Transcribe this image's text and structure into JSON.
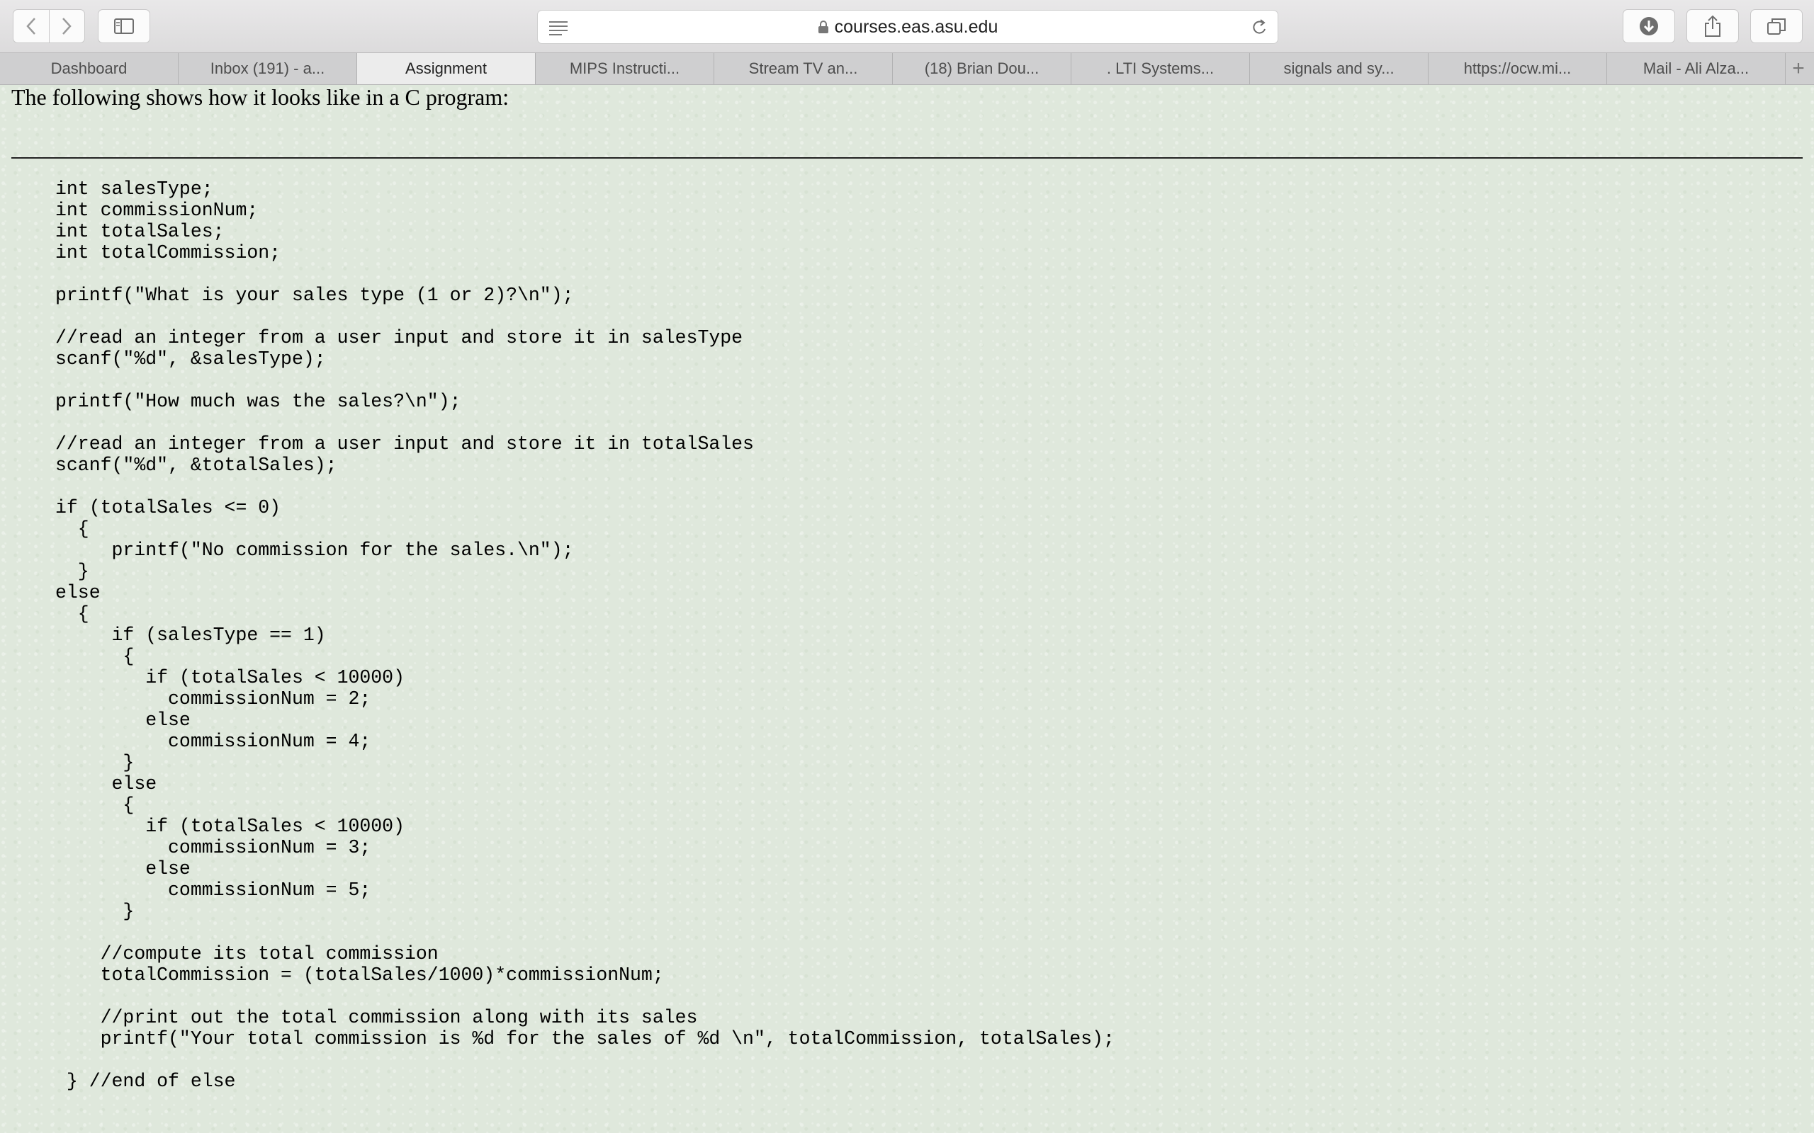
{
  "toolbar": {
    "url": "courses.eas.asu.edu"
  },
  "tabs": [
    {
      "label": "Dashboard"
    },
    {
      "label": "Inbox (191) - a..."
    },
    {
      "label": "Assignment"
    },
    {
      "label": "MIPS Instructi..."
    },
    {
      "label": "Stream TV an..."
    },
    {
      "label": "(18) Brian Dou..."
    },
    {
      "label": ". LTI Systems..."
    },
    {
      "label": "signals and sy..."
    },
    {
      "label": "https://ocw.mi..."
    },
    {
      "label": "Mail - Ali Alza..."
    }
  ],
  "page": {
    "intro": "The following shows how it looks like in a C program:",
    "code": "int salesType;\nint commissionNum;\nint totalSales;\nint totalCommission;\n\nprintf(\"What is your sales type (1 or 2)?\\n\");\n\n//read an integer from a user input and store it in salesType\nscanf(\"%d\", &salesType);\n\nprintf(\"How much was the sales?\\n\");\n\n//read an integer from a user input and store it in totalSales\nscanf(\"%d\", &totalSales);\n\nif (totalSales <= 0)\n  {\n     printf(\"No commission for the sales.\\n\");\n  }\nelse\n  {\n     if (salesType == 1)\n      {\n        if (totalSales < 10000)\n          commissionNum = 2;\n        else\n          commissionNum = 4;\n      }\n     else\n      {\n        if (totalSales < 10000)\n          commissionNum = 3;\n        else\n          commissionNum = 5;\n      }\n\n    //compute its total commission\n    totalCommission = (totalSales/1000)*commissionNum;\n\n    //print out the total commission along with its sales\n    printf(\"Your total commission is %d for the sales of %d \\n\", totalCommission, totalSales);\n\n } //end of else"
  }
}
